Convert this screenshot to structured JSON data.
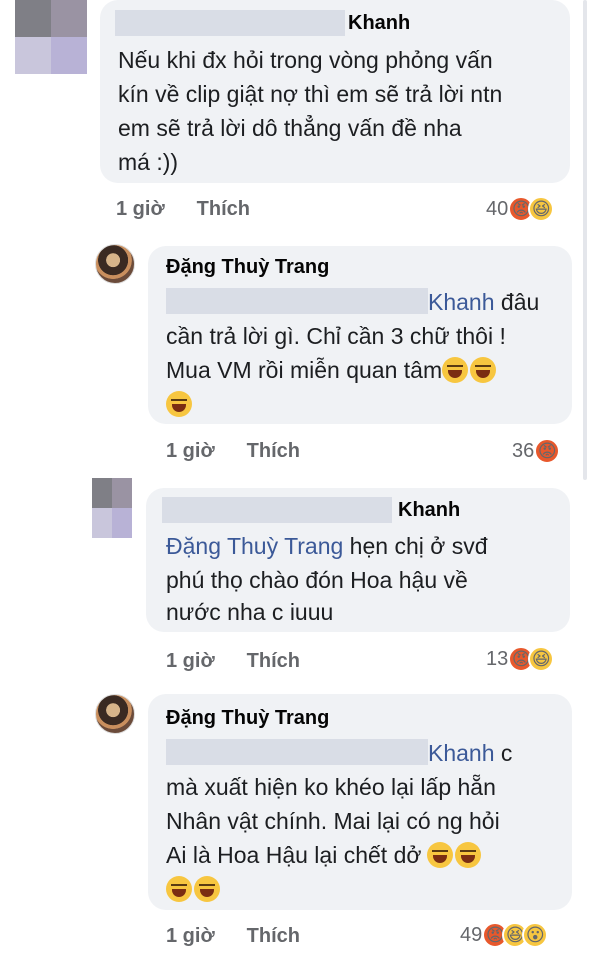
{
  "comments": [
    {
      "author": "Khanh",
      "lines": [
        "Nếu khi đx hỏi trong vòng phỏng vấn",
        "kín về clip giật nợ thì em sẽ trả lời ntn",
        "em sẽ trả lời dô thẳng vấn đề nha",
        "má :))"
      ],
      "time": "1 giờ",
      "like": "Thích",
      "count": "40",
      "reactions": [
        "angry",
        "haha"
      ]
    },
    {
      "author": "Đặng Thuỳ Trang",
      "mention": "Khanh",
      "line1_suffix": " đâu",
      "lines": [
        "cần trả lời gì. Chỉ cần 3 chữ thôi !",
        "Mua VM rồi miễn quan tâm"
      ],
      "time": "1 giờ",
      "like": "Thích",
      "count": "36",
      "reactions": [
        "angry"
      ]
    },
    {
      "author": "Khanh",
      "mention": "Đặng Thuỳ Trang",
      "line1_suffix": "  hẹn chị ở svđ",
      "lines": [
        "phú thọ chào đón Hoa hậu về",
        "nước nha c iuuu"
      ],
      "time": "1 giờ",
      "like": "Thích",
      "count": "13",
      "reactions": [
        "angry",
        "haha"
      ]
    },
    {
      "author": "Đặng Thuỳ Trang",
      "mention": "Khanh",
      "line1_suffix": " c",
      "lines": [
        "mà xuất hiện ko khéo lại lấp hẵn",
        "Nhân vật chính. Mai lại có ng hỏi",
        "Ai là Hoa Hậu lại chết dở"
      ],
      "time": "1 giờ",
      "like": "Thích",
      "count": "49",
      "reactions": [
        "angry",
        "haha",
        "wow"
      ]
    }
  ],
  "icons": {
    "angry": "angry-reaction-icon",
    "haha": "haha-reaction-icon",
    "wow": "wow-reaction-icon"
  }
}
